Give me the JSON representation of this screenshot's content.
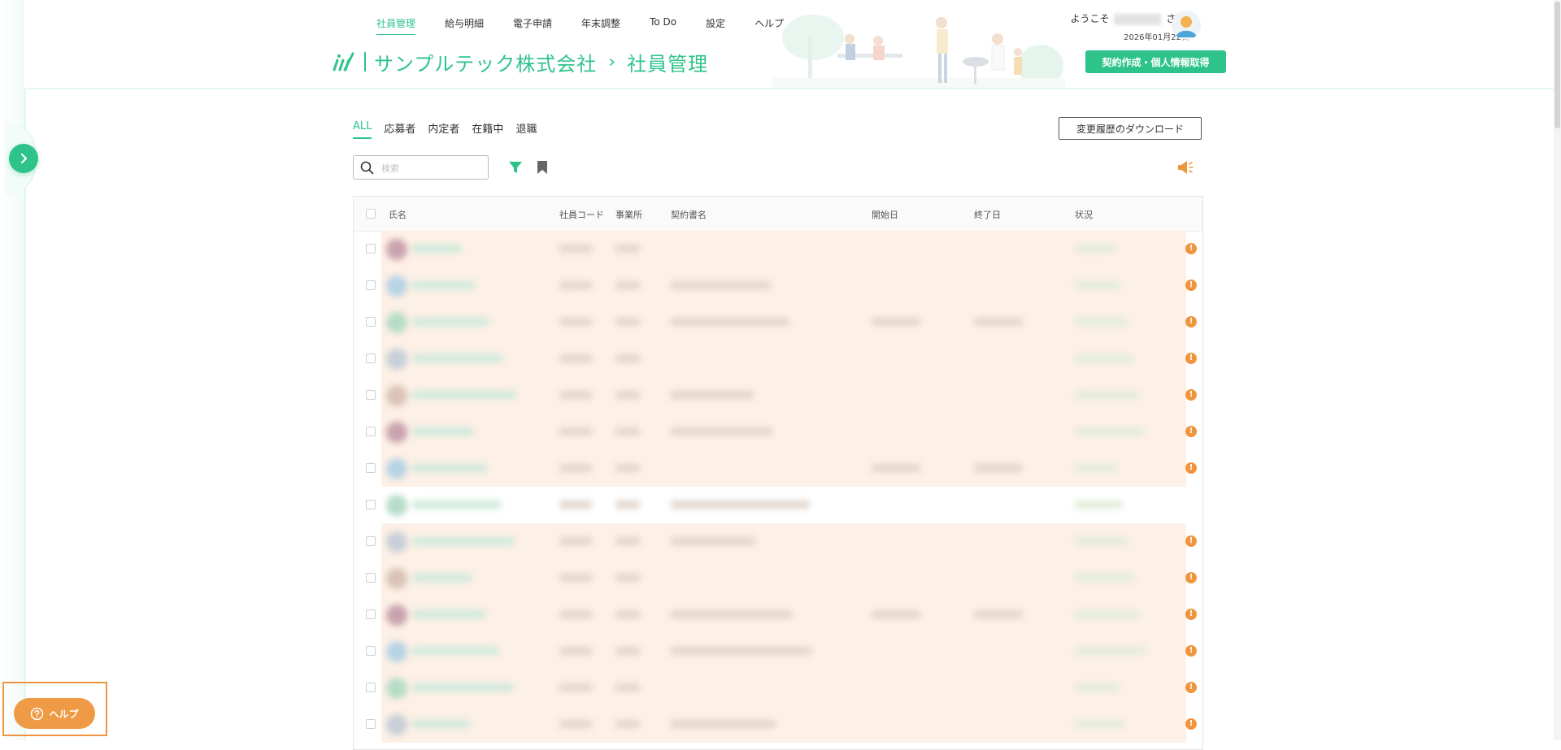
{
  "nav": [
    {
      "label": "社員管理",
      "active": true
    },
    {
      "label": "給与明細"
    },
    {
      "label": "電子申請"
    },
    {
      "label": "年末調整"
    },
    {
      "label": "To Do"
    },
    {
      "label": "設定"
    },
    {
      "label": "ヘルプ"
    }
  ],
  "brand": {
    "company": "サンプルテック株式会社",
    "separator": "›",
    "page": "社員管理"
  },
  "user": {
    "welcome_prefix": "ようこそ",
    "welcome_suffix": "さん!",
    "date": "2026年01月22日"
  },
  "header": {
    "cta_label": "契約作成・個人情報取得"
  },
  "tabs": [
    {
      "label": "ALL",
      "active": true
    },
    {
      "label": "応募者"
    },
    {
      "label": "内定者"
    },
    {
      "label": "在籍中"
    },
    {
      "label": "退職"
    }
  ],
  "toolbar": {
    "download_label": "変更履歴のダウンロード",
    "search_placeholder": "検索"
  },
  "table": {
    "columns": [
      "氏名",
      "社員コード",
      "事業所",
      "契約書名",
      "開始日",
      "終了日",
      "状況"
    ],
    "warning_symbol": "!",
    "row_count_visible": 14
  },
  "help": {
    "label": "ヘルプ"
  },
  "colors": {
    "accent": "#2ec38b",
    "warning": "#f0953e",
    "row_highlight": "#fdf0e6"
  },
  "icons": {
    "sidebar_toggle": "chevron-right-icon",
    "search": "search-icon",
    "filter": "filter-icon",
    "bookmark": "bookmark-icon",
    "announcement": "megaphone-icon",
    "help": "question-circle-icon"
  }
}
